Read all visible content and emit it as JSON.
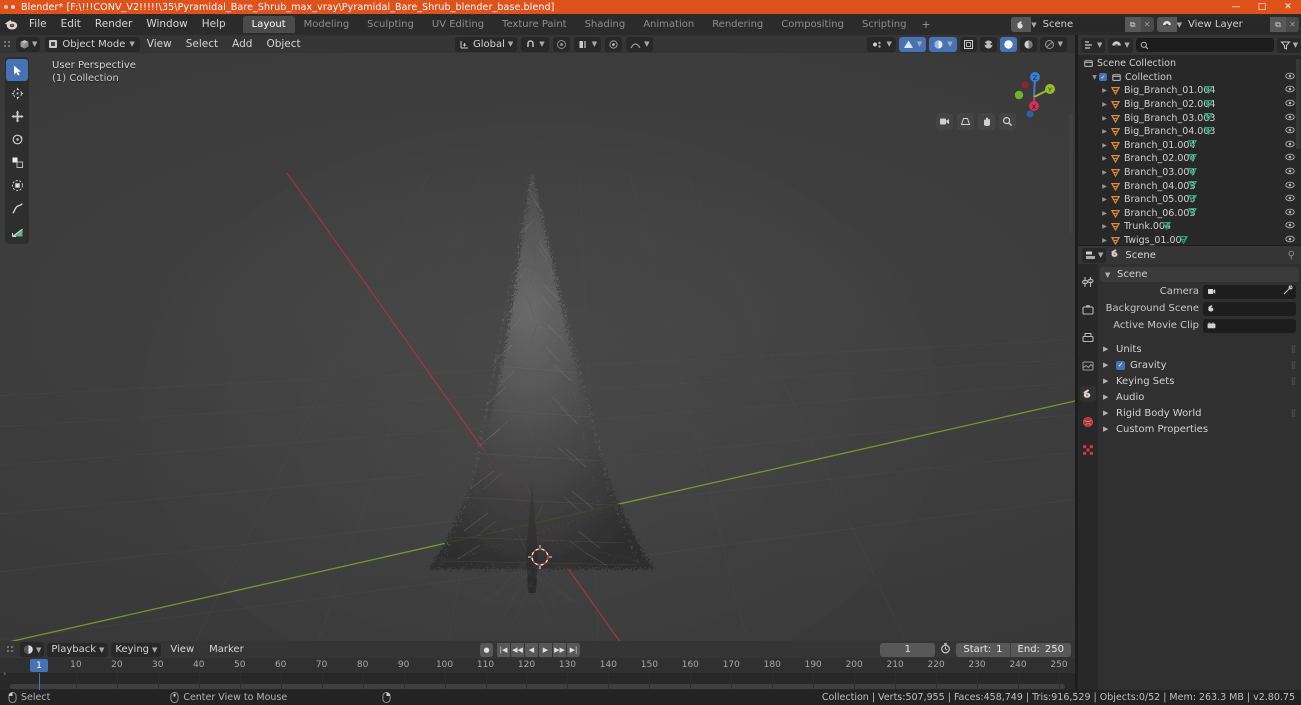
{
  "window": {
    "title": "Blender* [F:\\!!!CONV_V2!!!!!\\35\\Pyramidal_Bare_Shrub_max_vray\\Pyramidal_Bare_Shrub_blender_base.blend]",
    "minimize": "—",
    "maximize": "□",
    "close": "✕"
  },
  "topbar": {
    "menus": [
      "File",
      "Edit",
      "Render",
      "Window",
      "Help"
    ],
    "tabs": [
      {
        "label": "Layout",
        "active": true
      },
      {
        "label": "Modeling",
        "active": false
      },
      {
        "label": "Sculpting",
        "active": false
      },
      {
        "label": "UV Editing",
        "active": false
      },
      {
        "label": "Texture Paint",
        "active": false
      },
      {
        "label": "Shading",
        "active": false
      },
      {
        "label": "Animation",
        "active": false
      },
      {
        "label": "Rendering",
        "active": false
      },
      {
        "label": "Compositing",
        "active": false
      },
      {
        "label": "Scripting",
        "active": false
      }
    ],
    "add_tab": "+",
    "scene_name": "Scene",
    "view_layer_name": "View Layer"
  },
  "viewport_header": {
    "mode": "Object Mode",
    "menus": [
      "View",
      "Select",
      "Add",
      "Object"
    ],
    "transform_orientation": "Global"
  },
  "viewport": {
    "perspective_label": "User Perspective",
    "collection_label": "(1) Collection",
    "gizmo_axes": {
      "x": "X",
      "y": "Y",
      "z": "Z"
    },
    "tools": [
      "select-box-tool",
      "cursor-tool",
      "move-tool",
      "rotate-tool",
      "scale-tool",
      "transform-tool",
      "annotate-tool",
      "measure-tool"
    ]
  },
  "outliner": {
    "search_placeholder": "",
    "scene_collection": "Scene Collection",
    "collection": "Collection",
    "items": [
      {
        "name": "Big_Branch_01.004"
      },
      {
        "name": "Big_Branch_02.004"
      },
      {
        "name": "Big_Branch_03.003"
      },
      {
        "name": "Big_Branch_04.003"
      },
      {
        "name": "Branch_01.004"
      },
      {
        "name": "Branch_02.004"
      },
      {
        "name": "Branch_03.004"
      },
      {
        "name": "Branch_04.003"
      },
      {
        "name": "Branch_05.003"
      },
      {
        "name": "Branch_06.003"
      },
      {
        "name": "Trunk.004"
      },
      {
        "name": "Twigs_01.007"
      }
    ]
  },
  "properties": {
    "breadcrumb": "Scene",
    "panel_title": "Scene",
    "fields": [
      {
        "label": "Camera",
        "value": ""
      },
      {
        "label": "Background Scene",
        "value": ""
      },
      {
        "label": "Active Movie Clip",
        "value": ""
      }
    ],
    "sections": [
      {
        "label": "Units",
        "checkbox": false
      },
      {
        "label": "Gravity",
        "checkbox": true
      },
      {
        "label": "Keying Sets",
        "checkbox": false
      },
      {
        "label": "Audio",
        "checkbox": false
      },
      {
        "label": "Rigid Body World",
        "checkbox": false
      },
      {
        "label": "Custom Properties",
        "checkbox": false
      }
    ]
  },
  "timeline": {
    "menus": [
      "View",
      "Marker"
    ],
    "playback": "Playback",
    "keying": "Keying",
    "current_frame": "1",
    "start_label": "Start:",
    "start_value": "1",
    "end_label": "End:",
    "end_value": "250",
    "playhead_label": "1",
    "ticks": [
      {
        "label": "10",
        "frame": 10
      },
      {
        "label": "20",
        "frame": 20
      },
      {
        "label": "30",
        "frame": 30
      },
      {
        "label": "40",
        "frame": 40
      },
      {
        "label": "50",
        "frame": 50
      },
      {
        "label": "60",
        "frame": 60
      },
      {
        "label": "70",
        "frame": 70
      },
      {
        "label": "80",
        "frame": 80
      },
      {
        "label": "90",
        "frame": 90
      },
      {
        "label": "100",
        "frame": 100
      },
      {
        "label": "110",
        "frame": 110
      },
      {
        "label": "120",
        "frame": 120
      },
      {
        "label": "130",
        "frame": 130
      },
      {
        "label": "140",
        "frame": 140
      },
      {
        "label": "150",
        "frame": 150
      },
      {
        "label": "160",
        "frame": 160
      },
      {
        "label": "170",
        "frame": 170
      },
      {
        "label": "180",
        "frame": 180
      },
      {
        "label": "190",
        "frame": 190
      },
      {
        "label": "200",
        "frame": 200
      },
      {
        "label": "210",
        "frame": 210
      },
      {
        "label": "220",
        "frame": 220
      },
      {
        "label": "230",
        "frame": 230
      },
      {
        "label": "240",
        "frame": 240
      },
      {
        "label": "250",
        "frame": 250
      }
    ]
  },
  "statusbar": {
    "left_action": "Select",
    "middle_action": "Center View to Mouse",
    "stats": "Collection | Verts:507,955 | Faces:458,749 | Tris:916,529 | Objects:0/52 | Mem: 263.3 MB | v2.80.75"
  },
  "colors": {
    "accent_orange": "#e0521c",
    "accent_blue": "#4772b3",
    "mesh_green": "#2fa07a",
    "object_orange": "#e08a3c",
    "axis_x": "#cc3355",
    "axis_y": "#9bbc2a",
    "axis_z": "#3b7fd4"
  }
}
